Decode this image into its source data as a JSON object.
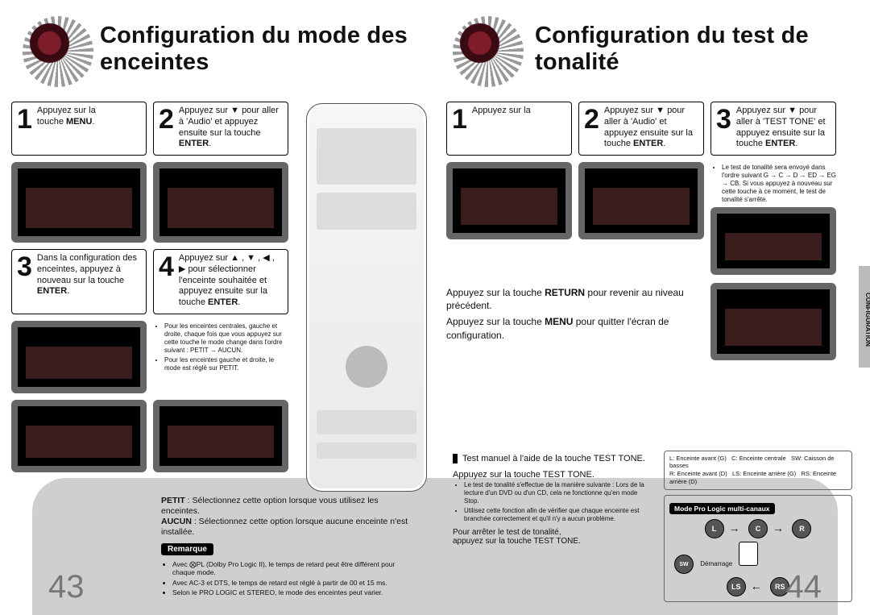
{
  "left": {
    "title": "Configuration du mode des enceintes",
    "page_number": "43",
    "steps": {
      "s1": {
        "num": "1",
        "text_a": "Appuyez sur la",
        "text_b": "touche ",
        "key": "MENU",
        "text_c": "."
      },
      "s2": {
        "num": "2",
        "text": "Appuyez sur ▼ pour aller à 'Audio' et appuyez ensuite sur la touche ",
        "key": "ENTER",
        "suffix": "."
      },
      "s3": {
        "num": "3",
        "text": "Dans la configuration des enceintes, appuyez à nouveau sur la touche ",
        "key": "ENTER",
        "suffix": "."
      },
      "s4": {
        "num": "4",
        "text": "Appuyez sur ▲ , ▼ , ◀ , ▶ pour sélectionner l'enceinte souhaitée et appuyez ensuite sur la touche ",
        "key": "ENTER",
        "suffix": "."
      }
    },
    "step4_bullets": [
      "Pour les enceintes centrales, gauche et droite, chaque fois que vous appuyez sur cette touche le mode change dans l'ordre suivant : PETIT → AUCUN.",
      "Pour les enceintes gauche et droite, le mode est réglé sur PETIT."
    ],
    "footer": {
      "petit_line_label": "PETIT",
      "petit_line_text": " : Sélectionnez cette option lorsque vous utilisez les enceintes.",
      "aucun_line_label": "AUCUN",
      "aucun_line_text": " : Sélectionnez cette option lorsque aucune enceinte n'est installée.",
      "remarque_label": "Remarque",
      "bullets": [
        "Avec ⨂PL (Dolby Pro Logic II), le temps de retard peut être différent pour chaque mode.",
        "Avec AC-3 et DTS, le temps de retard est réglé à partir de 00 et 15 ms.",
        "Selon le PRO LOGIC et STEREO, le mode des enceintes peut varier."
      ]
    }
  },
  "right": {
    "title": "Configuration du test de tonalité",
    "page_number": "44",
    "side_tab": "CONFIGURATION",
    "steps": {
      "s1": {
        "num": "1",
        "text": "Appuyez sur la"
      },
      "s2": {
        "num": "2",
        "text": "Appuyez sur ▼ pour aller à 'Audio' et appuyez ensuite sur la touche ",
        "key": "ENTER",
        "suffix": "."
      },
      "s3": {
        "num": "3",
        "text": "Appuyez sur ▼ pour aller à 'TEST TONE' et appuyez ensuite sur la touche ",
        "key": "ENTER",
        "suffix": "."
      }
    },
    "s3_bullets": [
      "Le test de tonalité sera envoyé dans l'ordre suivant G → C → D → ED → EG → CB. Si vous appuyez à nouveau sur cette touche à ce moment, le test de tonalité s'arrête."
    ],
    "mid": {
      "return_text_a": "Appuyez sur la touche ",
      "return_key": "RETURN",
      "return_text_b": " pour revenir au niveau précédent.",
      "menu_text_a": "Appuyez sur la touche ",
      "menu_key": "MENU",
      "menu_text_b": " pour quitter l'écran de configuration."
    },
    "footer": {
      "manual_test": "Test manuel à l'aide de la touche TEST TONE.",
      "press_test": "Appuyez sur la touche TEST TONE.",
      "bullets": [
        "Le test de tonalité s'effectue de la manière suivante : Lors de la lecture d'un DVD ou d'un CD, cela ne fonctionne qu'en mode Stop.",
        "Utilisez cette fonction afin de vérifier que chaque enceinte est branchée correctement et qu'il n'y a aucun problème."
      ],
      "stop_a": "Pour arrêter le test de tonalité,",
      "stop_b": "appuyez sur la touche TEST TONE.",
      "legend": {
        "L": "L: Enceinte avant (G)",
        "C": "C: Enceinte centrale",
        "SW": "SW: Caisson de basses",
        "R": "R: Enceinte avant (D)",
        "LS": "LS: Enceinte arrière (G)",
        "RS": "RS: Enceinte arrière (D)"
      },
      "mode_label": "Mode Pro Logic multi-canaux",
      "demarrage": "Démarrage",
      "spk": {
        "L": "L",
        "C": "C",
        "R": "R",
        "SW": "SW",
        "LS": "LS",
        "RS": "RS"
      }
    }
  }
}
